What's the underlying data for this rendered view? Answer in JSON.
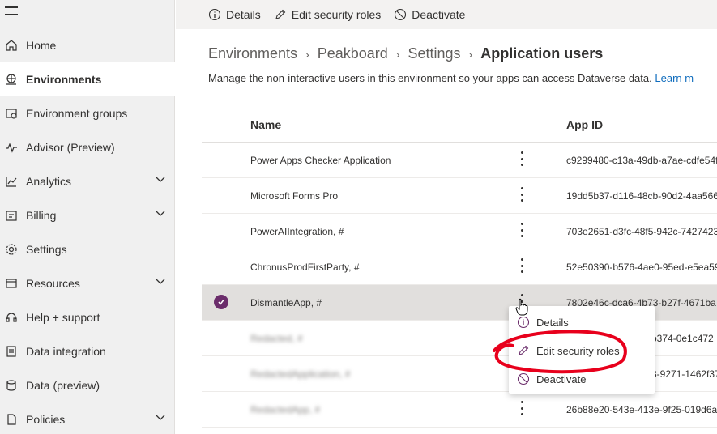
{
  "sidebar": {
    "items": [
      {
        "label": "Home",
        "icon": "home-icon"
      },
      {
        "label": "Environments",
        "icon": "environments-icon",
        "active": true
      },
      {
        "label": "Environment groups",
        "icon": "environment-groups-icon"
      },
      {
        "label": "Advisor (Preview)",
        "icon": "advisor-icon"
      },
      {
        "label": "Analytics",
        "icon": "analytics-icon",
        "expandable": true
      },
      {
        "label": "Billing",
        "icon": "billing-icon",
        "expandable": true
      },
      {
        "label": "Settings",
        "icon": "settings-icon"
      },
      {
        "label": "Resources",
        "icon": "resources-icon",
        "expandable": true
      },
      {
        "label": "Help + support",
        "icon": "help-icon"
      },
      {
        "label": "Data integration",
        "icon": "data-integration-icon"
      },
      {
        "label": "Data (preview)",
        "icon": "data-preview-icon"
      },
      {
        "label": "Policies",
        "icon": "policies-icon",
        "expandable": true
      }
    ]
  },
  "commandbar": {
    "details": "Details",
    "edit_roles": "Edit security roles",
    "deactivate": "Deactivate"
  },
  "breadcrumb": {
    "b1": "Environments",
    "b2": "Peakboard",
    "b3": "Settings",
    "current": "Application users"
  },
  "description": {
    "text": "Manage the non-interactive users in this environment so your apps can access Dataverse data.",
    "link": "Learn m"
  },
  "table": {
    "col_name": "Name",
    "col_appid": "App ID",
    "rows": [
      {
        "name": "Power Apps Checker Application",
        "appid": "c9299480-c13a-49db-a7ae-cdfe54f"
      },
      {
        "name": "Microsoft Forms Pro",
        "appid": "19dd5b37-d116-48cb-90d2-4aa566"
      },
      {
        "name": "PowerAIIntegration, #",
        "appid": "703e2651-d3fc-48f5-942c-7427423"
      },
      {
        "name": "ChronusProdFirstParty, #",
        "appid": "52e50390-b576-4ae0-95ed-e5ea59"
      },
      {
        "name": "DismantleApp, #",
        "appid": "7802e46c-dca6-4b73-b27f-4671ba"
      },
      {
        "name": "Redacted, #",
        "appid": "b374-0e1c472"
      },
      {
        "name": "RedactedApplication, #",
        "appid": "3-9271-1462f37"
      },
      {
        "name": "RedactedApp, #",
        "appid": "26b88e20-543e-413e-9f25-019d6a"
      }
    ]
  },
  "context_menu": {
    "details": "Details",
    "edit_roles": "Edit security roles",
    "deactivate": "Deactivate"
  },
  "colors": {
    "accent": "#6b2d6b",
    "annotation": "#e8001c",
    "link": "#0f6cbd"
  }
}
